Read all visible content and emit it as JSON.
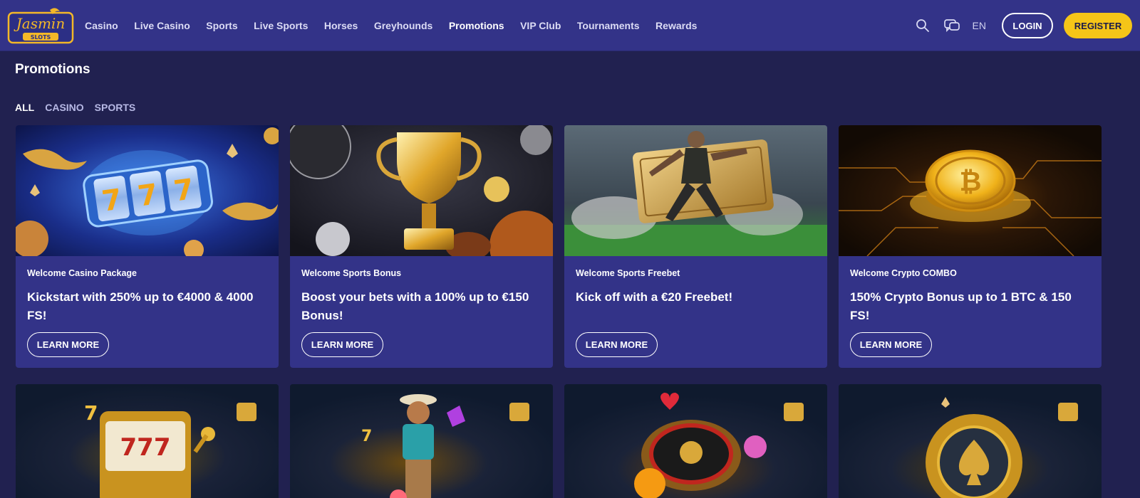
{
  "brand": {
    "name": "Jasmin",
    "sub": "SLOTS"
  },
  "nav": {
    "items": [
      "Casino",
      "Live Casino",
      "Sports",
      "Live Sports",
      "Horses",
      "Greyhounds",
      "Promotions",
      "VIP Club",
      "Tournaments",
      "Rewards"
    ],
    "active": "Promotions"
  },
  "header": {
    "lang": "EN",
    "login": "LOGIN",
    "register": "REGISTER",
    "search_icon": "search-icon",
    "chat_icon": "chat-icon"
  },
  "page": {
    "title": "Promotions"
  },
  "filters": {
    "items": [
      "ALL",
      "CASINO",
      "SPORTS"
    ],
    "active": "ALL"
  },
  "colors": {
    "bg": "#212150",
    "header": "#333388",
    "card": "#333388",
    "accent": "#f5c518"
  },
  "promotions": [
    {
      "category": "Welcome Casino Package",
      "headline": "Kickstart with 250% up to €4000 & 4000 FS!",
      "cta": "LEARN MORE"
    },
    {
      "category": "Welcome Sports Bonus",
      "headline": "Boost your bets with a 100% up to €150 Bonus!",
      "cta": "LEARN MORE"
    },
    {
      "category": "Welcome Sports Freebet",
      "headline": "Kick off with a €20 Freebet!",
      "cta": "LEARN MORE"
    },
    {
      "category": "Welcome Crypto COMBO",
      "headline": "150% Crypto Bonus up to 1 BTC & 150 FS!",
      "cta": "LEARN MORE"
    }
  ],
  "slot_reel": "777"
}
